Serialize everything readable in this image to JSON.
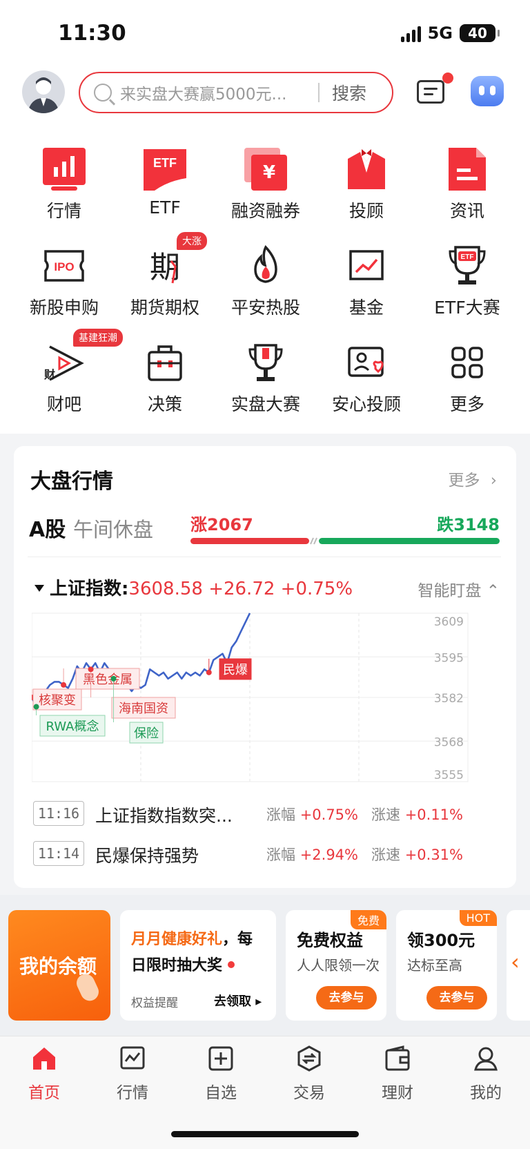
{
  "status": {
    "time": "11:30",
    "network": "5G",
    "battery": "40"
  },
  "header": {
    "search_placeholder": "来实盘大赛赢5000元...",
    "search_button": "搜索"
  },
  "menu": {
    "row1": [
      "行情",
      "ETF",
      "融资融券",
      "投顾",
      "资讯"
    ],
    "row2": [
      "新股申购",
      "期货期权",
      "平安热股",
      "基金",
      "ETF大赛"
    ],
    "row3": [
      "财吧",
      "决策",
      "实盘大赛",
      "安心投顾",
      "更多"
    ],
    "badges": {
      "futures": "大涨",
      "forum": "基建狂潮"
    },
    "icon_text": {
      "etf": "ETF",
      "yuan": "¥",
      "ipo": "IPO",
      "futures": "期",
      "forum": "财",
      "cup": "ETF"
    }
  },
  "market": {
    "title": "大盘行情",
    "more": "更多",
    "a_share": "A股",
    "session": "午间休盘",
    "up": "涨2067",
    "down": "跌3148",
    "up_count": 2067,
    "down_count": 3148,
    "index_name": "上证指数:",
    "index_values": "3608.58 +26.72 +0.75%",
    "watch": "智能盯盘",
    "colors": {
      "up": "#e8373d",
      "down": "#17a85b"
    }
  },
  "chart_data": {
    "type": "line",
    "yticks": [
      "3609",
      "3595",
      "3582",
      "3568",
      "3555"
    ],
    "ylim": [
      3555,
      3609
    ],
    "series": [
      {
        "values": [
          3582,
          3579,
          3583,
          3584,
          3586,
          3587,
          3587,
          3586,
          3585,
          3588,
          3592,
          3590,
          3593,
          3591,
          3593,
          3590,
          3593,
          3591,
          3588,
          3586,
          3585,
          3586,
          3584,
          3586,
          3585,
          3586,
          3591,
          3590,
          3589,
          3590,
          3588,
          3589,
          3590,
          3588,
          3590,
          3589,
          3590,
          3589,
          3591,
          3590,
          3594,
          3595,
          3596,
          3593,
          3598,
          3600,
          3603,
          3606,
          3609
        ]
      }
    ],
    "annotations": [
      {
        "label": "核聚变",
        "style": "up"
      },
      {
        "label": "RWA概念",
        "style": "down"
      },
      {
        "label": "黑色金属",
        "style": "up"
      },
      {
        "label": "海南国资",
        "style": "up"
      },
      {
        "label": "保险",
        "style": "down"
      },
      {
        "label": "民爆",
        "style": "solid"
      }
    ]
  },
  "news": [
    {
      "time": "11:16",
      "title": "上证指数指数突...",
      "change_label": "涨幅",
      "change": "+0.75%",
      "speed_label": "涨速",
      "speed": "+0.11%"
    },
    {
      "time": "11:14",
      "title": "民爆保持强势",
      "change_label": "涨幅",
      "change": "+2.94%",
      "speed_label": "涨速",
      "speed": "+0.31%"
    }
  ],
  "promo": {
    "balance": "我的余额",
    "health_highlight": "月月健康好礼",
    "health_rest": "，每",
    "health_line2": "日限时抽大奖",
    "health_tip": "权益提醒",
    "health_action": "去领取",
    "free_tag": "免费",
    "free_title": "免费权益",
    "free_sub": "人人限领一次",
    "free_button": "去参与",
    "hot_tag": "HOT",
    "hot_title": "领300元",
    "hot_sub": "达标至高",
    "hot_button": "去参与"
  },
  "tabs": [
    "首页",
    "行情",
    "自选",
    "交易",
    "理财",
    "我的"
  ]
}
